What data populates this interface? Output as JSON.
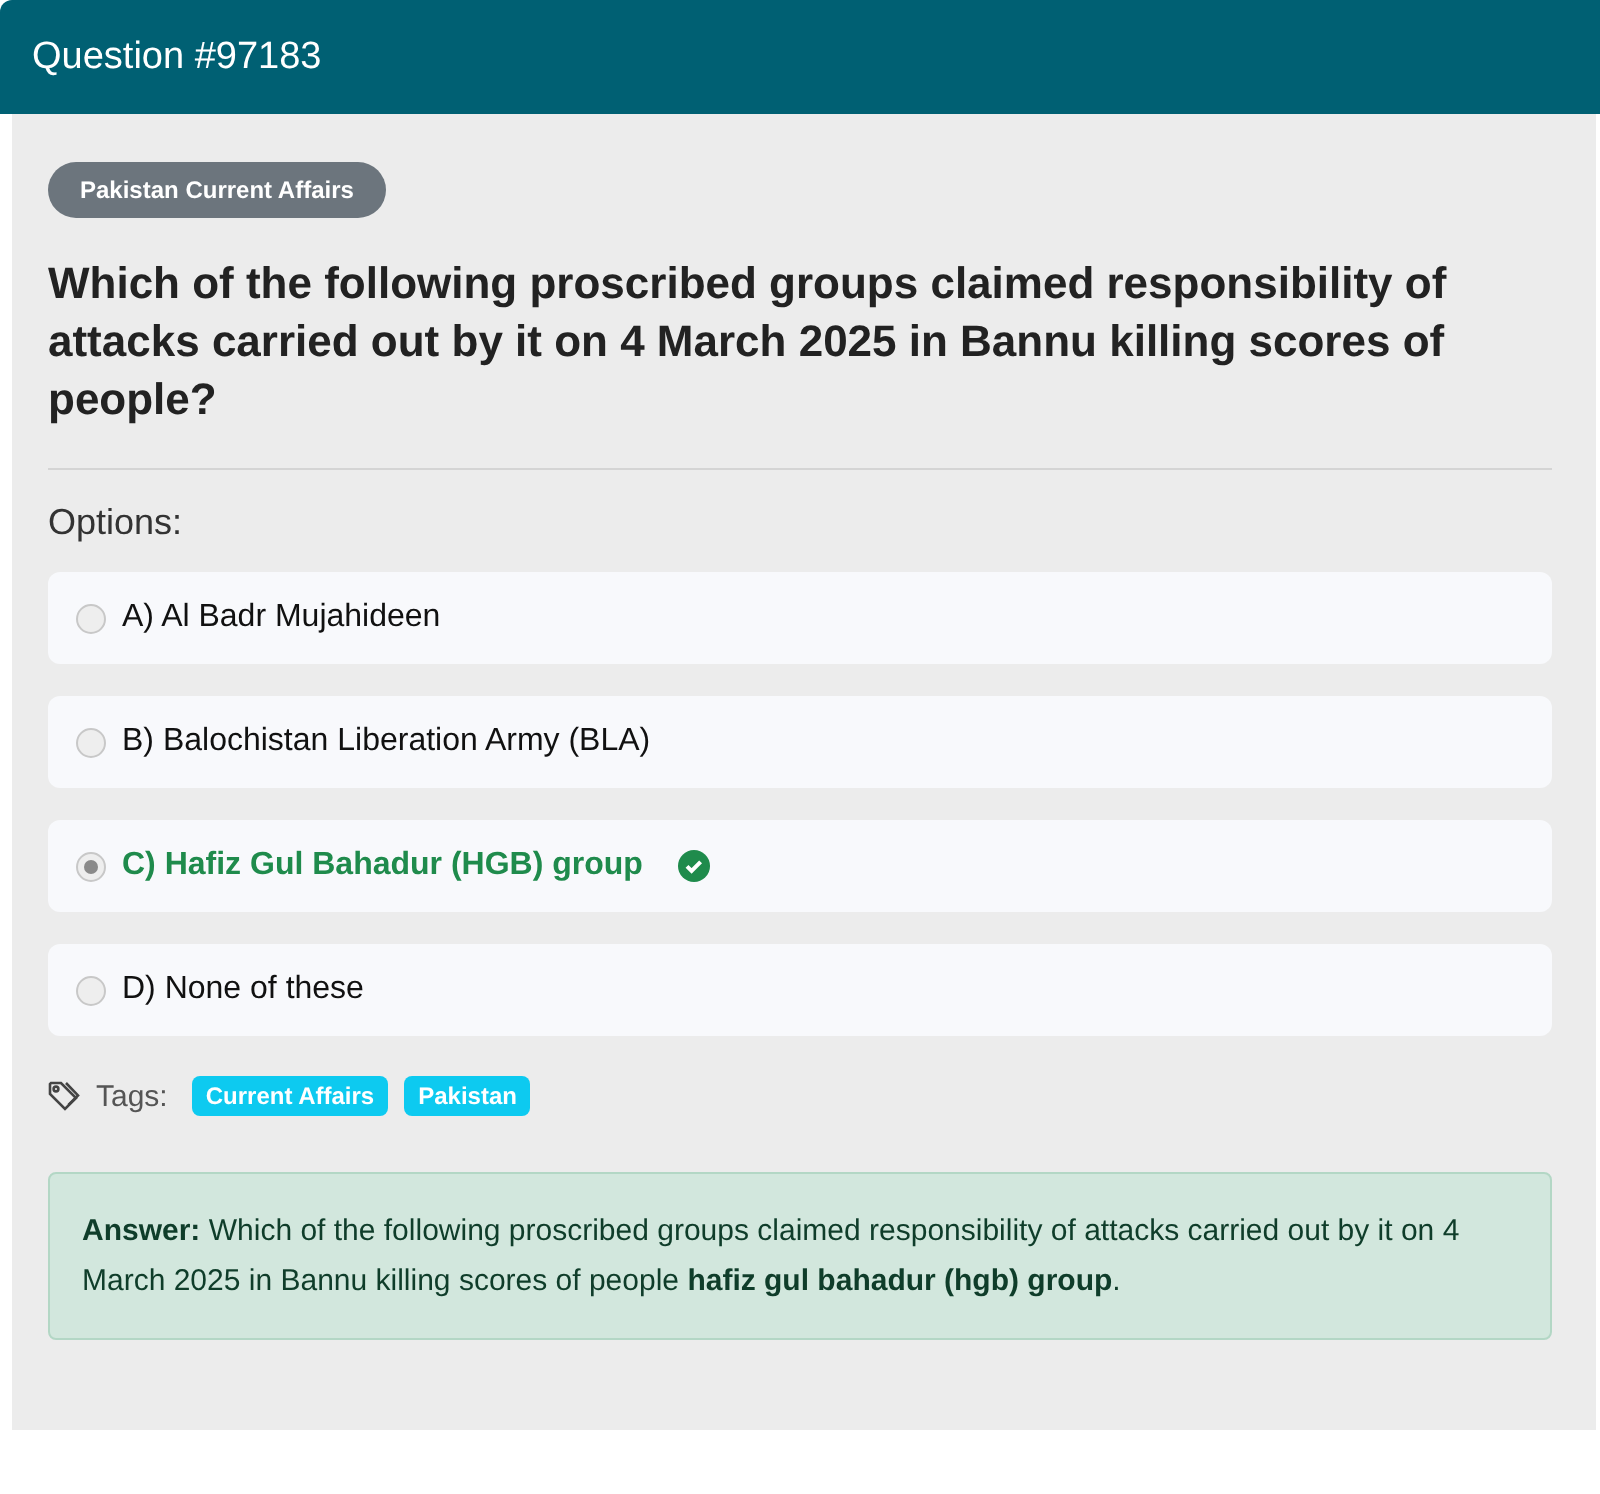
{
  "header": {
    "title": "Question #97183"
  },
  "category": "Pakistan Current Affairs",
  "question": "Which of the following proscribed groups claimed responsibility of attacks carried out by it on 4 March 2025 in Bannu killing scores of people?",
  "options_label": "Options:",
  "options": [
    {
      "label": "A) Al Badr Mujahideen",
      "selected": false,
      "correct": false
    },
    {
      "label": "B) Balochistan Liberation Army (BLA)",
      "selected": false,
      "correct": false
    },
    {
      "label": "C) Hafiz Gul Bahadur (HGB) group",
      "selected": true,
      "correct": true
    },
    {
      "label": "D) None of these",
      "selected": false,
      "correct": false
    }
  ],
  "tags_label": "Tags:",
  "tags": [
    "Current Affairs",
    "Pakistan"
  ],
  "answer": "**Answer:** Which of the following proscribed groups claimed responsibility of attacks carried out by it on 4 March 2025 in Bannu killing scores of people **hafiz gul bahadur (hgb) group**."
}
